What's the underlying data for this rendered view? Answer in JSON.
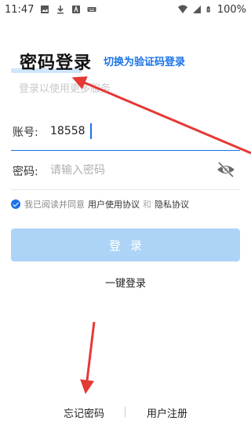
{
  "status_bar": {
    "time": "11:47",
    "battery": "100%"
  },
  "header": {
    "title": "密码登录",
    "switch_link": "切换为验证码登录",
    "subtitle": "登录以使用更多服务"
  },
  "form": {
    "account_label": "账号:",
    "account_value": "18558",
    "password_label": "密码:",
    "password_placeholder": "请输入密码"
  },
  "agreement": {
    "prefix": "我已阅读并同意",
    "user_agreement": "用户使用协议",
    "and": "和",
    "privacy": "隐私协议"
  },
  "buttons": {
    "login": "登录",
    "one_click": "一键登录",
    "forgot": "忘记密码",
    "register": "用户注册"
  },
  "colors": {
    "accent": "#1a73e8",
    "button_disabled": "#add4f6",
    "annotation": "#e53935"
  }
}
